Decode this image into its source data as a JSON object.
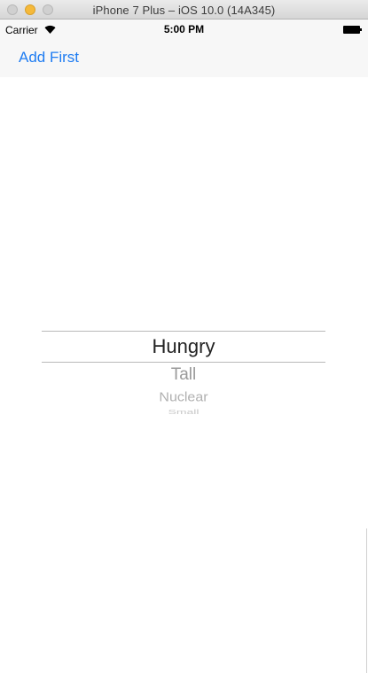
{
  "window": {
    "title": "iPhone 7 Plus – iOS 10.0 (14A345)"
  },
  "status_bar": {
    "carrier": "Carrier",
    "time": "5:00 PM"
  },
  "nav_bar": {
    "add_first_label": "Add First"
  },
  "picker": {
    "selected": "Hungry",
    "rows": [
      "Tall",
      "Nuclear",
      "Small"
    ]
  },
  "colors": {
    "tint": "#1e7cf2",
    "nav_background": "#f7f7f7"
  }
}
